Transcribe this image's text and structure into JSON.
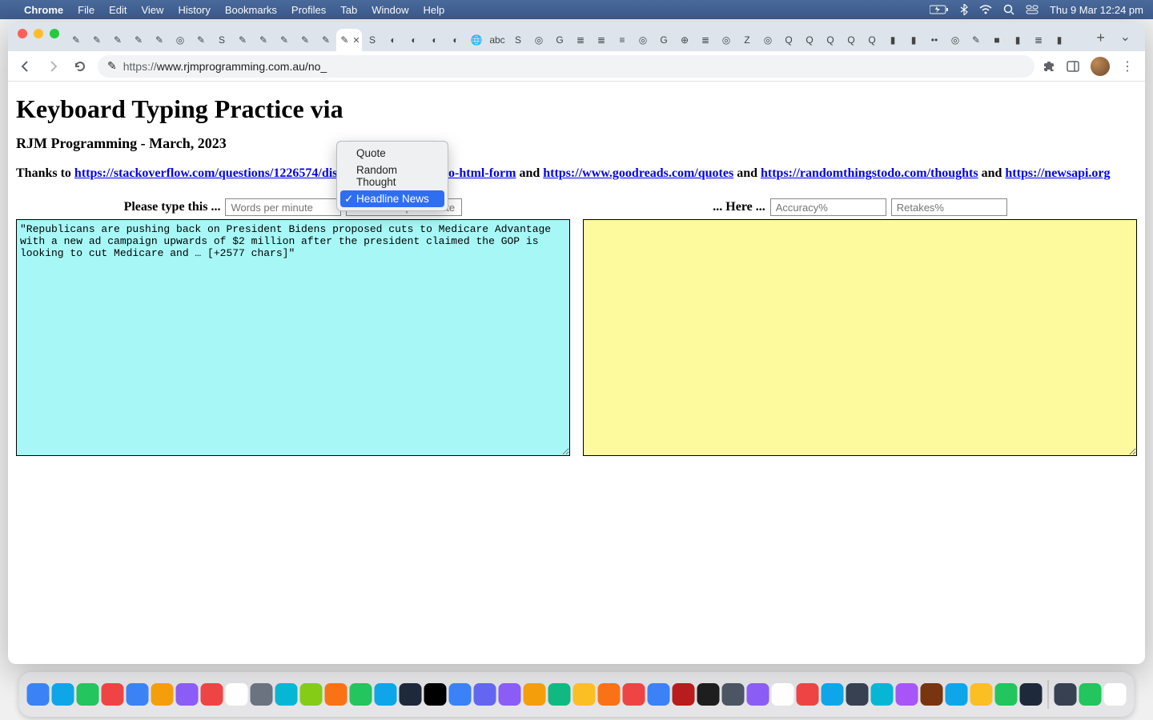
{
  "menubar": {
    "app": "Chrome",
    "items": [
      "File",
      "Edit",
      "View",
      "History",
      "Bookmarks",
      "Profiles",
      "Tab",
      "Window",
      "Help"
    ],
    "clock": "Thu 9 Mar  12:24 pm"
  },
  "browser": {
    "url_scheme": "https://",
    "url_rest": "www.rjmprogramming.com.au/no_"
  },
  "dropdown": {
    "options": [
      "Quote",
      "Random Thought",
      "Headline News"
    ],
    "selected_index": 2
  },
  "page": {
    "h1": "Keyboard Typing Practice via",
    "sub": "RJM Programming - March, 2023",
    "thanks_prefix": "Thanks to ",
    "links": [
      "https://stackoverflow.com/questions/1226574/disable-pasting-text-into-html-form",
      "https://www.goodreads.com/quotes",
      "https://randomthingstodo.com/thoughts",
      "https://newsapi.org"
    ],
    "and": " and ",
    "left_label": "Please type this ...",
    "right_label": "... Here ...",
    "wpm_placeholder": "Words per minute",
    "cpm_placeholder": "Characters per minute",
    "accuracy_placeholder": "Accuracy%",
    "retakes_placeholder": "Retakes%",
    "source_text": "\"Republicans are pushing back on President Bidens proposed cuts to Medicare Advantage with a new ad campaign upwards of $2 million after the president claimed the GOP is looking to cut Medicare and … [+2577 chars]\""
  },
  "tab_favicons": [
    "✎",
    "✎",
    "✎",
    "✎",
    "✎",
    "◎",
    "✎",
    "S",
    "✎",
    "✎",
    "✎",
    "✎",
    "✎",
    "✎",
    "S",
    "◐",
    "◐",
    "◐",
    "◐",
    "🌐",
    "abc",
    "S",
    "◎",
    "G",
    "≣",
    "≣",
    "≡",
    "◎",
    "G",
    "⊕",
    "≣",
    "◎",
    "Z",
    "◎",
    "Q",
    "Q",
    "Q",
    "Q",
    "Q",
    "▮",
    "▮",
    "••",
    "◎",
    "✎",
    "■",
    "▮",
    "≣",
    "▮"
  ],
  "tab_active_index": 13
}
